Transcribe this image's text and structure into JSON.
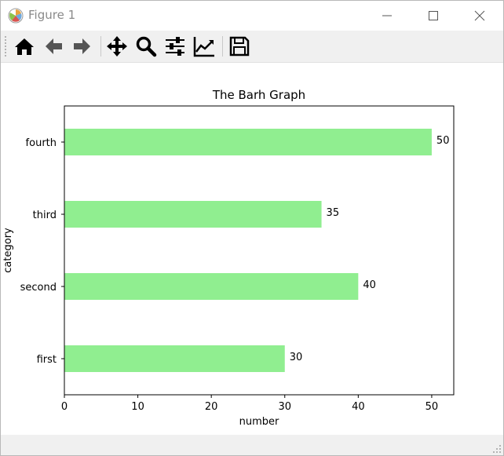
{
  "window": {
    "title": "Figure 1"
  },
  "toolbar": {
    "buttons": [
      {
        "name": "home-button",
        "icon": "home-icon"
      },
      {
        "name": "back-button",
        "icon": "arrow-left-icon"
      },
      {
        "name": "forward-button",
        "icon": "arrow-right-icon"
      },
      {
        "name": "pan-button",
        "icon": "move-icon"
      },
      {
        "name": "zoom-button",
        "icon": "search-icon"
      },
      {
        "name": "configure-subplots-button",
        "icon": "sliders-icon"
      },
      {
        "name": "edit-axis-button",
        "icon": "chart-line-icon"
      },
      {
        "name": "save-button",
        "icon": "floppy-disk-icon"
      }
    ]
  },
  "colors": {
    "bar": "#90ee90",
    "toolbar_bg": "#f0f0f0"
  },
  "chart_data": {
    "type": "bar",
    "orientation": "horizontal",
    "title": "The Barh Graph",
    "xlabel": "number",
    "ylabel": "category",
    "categories": [
      "first",
      "second",
      "third",
      "fourth"
    ],
    "values": [
      30,
      40,
      35,
      50
    ],
    "value_labels": [
      "30",
      "40",
      "35",
      "50"
    ],
    "xlim": [
      0,
      53
    ],
    "xticks": [
      0,
      10,
      20,
      30,
      40,
      50
    ],
    "grid": false,
    "legend": "none"
  }
}
